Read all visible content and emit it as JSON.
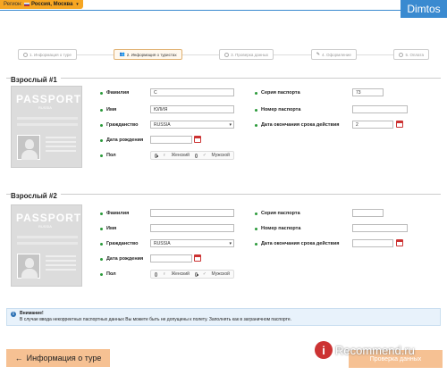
{
  "header": {
    "region_label": "Регион:",
    "region_value": "Россия, Москва",
    "watermark_user": "Dimtos"
  },
  "steps": [
    {
      "label": "1. Информация о туре"
    },
    {
      "label": "2. Информация о туристах"
    },
    {
      "label": "3. Проверка данных"
    },
    {
      "label": "4. Оформление"
    },
    {
      "label": "5. Оплата"
    }
  ],
  "passport_card": {
    "title": "PASSPORT",
    "subtitle": "RUSSIA"
  },
  "labels": {
    "lastname": "Фамилия",
    "firstname": "Имя",
    "citizenship": "Гражданство",
    "birthdate": "Дата рождения",
    "gender": "Пол",
    "female": "Женский",
    "male": "Мужской",
    "passport_series": "Серия паспорта",
    "passport_number": "Номер паспорта",
    "passport_expiry": "Дата окончания срока действия"
  },
  "tourists": [
    {
      "title": "Взрослый #1",
      "lastname": "С",
      "firstname": "ЮЛИЯ",
      "citizenship": "RUSSIA",
      "birthdate": "",
      "gender": "female",
      "passport_series": "73",
      "passport_number": "",
      "passport_expiry": "2"
    },
    {
      "title": "Взрослый #2",
      "lastname": "",
      "firstname": "",
      "citizenship": "RUSSIA",
      "birthdate": "",
      "gender": "male",
      "passport_series": "",
      "passport_number": "",
      "passport_expiry": ""
    }
  ],
  "notice": {
    "title": "Внимание!",
    "text": "В случае ввода некорректных паспортных данных Вы можете быть не допущены к полету. Заполнять как в заграничном паспорте."
  },
  "buttons": {
    "back": "Информация о туре",
    "next": "Проверка данных"
  },
  "watermark": {
    "site": "Recommend.ru",
    "logo_letter": "i"
  }
}
